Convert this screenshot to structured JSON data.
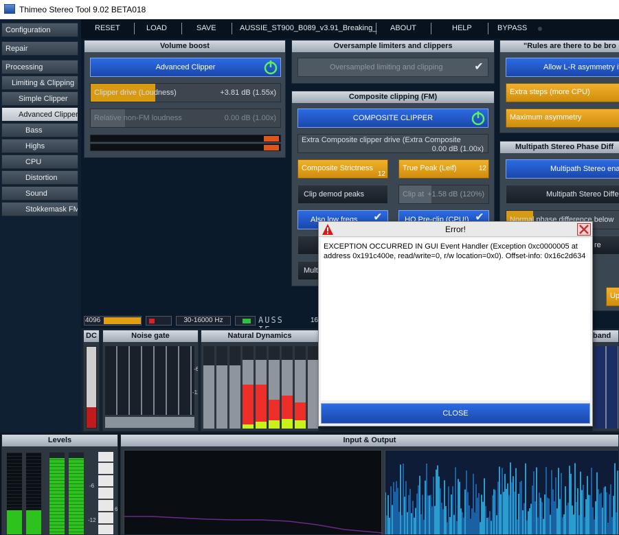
{
  "window": {
    "title": "Thimeo Stereo Tool 9.02 BETA018"
  },
  "nav": {
    "items": [
      {
        "label": "Configuration"
      },
      {
        "label": "Repair"
      },
      {
        "label": "Processing"
      },
      {
        "label": "Limiting & Clipping"
      },
      {
        "label": "Simple Clipper"
      },
      {
        "label": "Advanced Clipper"
      },
      {
        "label": "Bass"
      },
      {
        "label": "Highs"
      },
      {
        "label": "CPU"
      },
      {
        "label": "Distortion"
      },
      {
        "label": "Sound"
      },
      {
        "label": "Stokkemask FM"
      }
    ]
  },
  "menu": {
    "reset": "RESET",
    "load": "LOAD",
    "save": "SAVE",
    "preset": "AUSSIE_ST900_B089_v3.91_Breaking_",
    "about": "ABOUT",
    "help": "HELP",
    "bypass": "BYPASS"
  },
  "volume_boost": {
    "title": "Volume boost",
    "advanced_clipper": "Advanced Clipper",
    "clipper_drive_label": "Clipper drive (Loudness)",
    "clipper_drive_value": "+3.81 dB (1.55x)",
    "clipper_drive_fill": 0.34,
    "relative_label": "Relative non-FM loudness",
    "relative_value": "0.00 dB (1.00x)"
  },
  "oversample": {
    "title": "Oversample limiters and clippers",
    "button": "Oversampled limiting and clipping"
  },
  "composite": {
    "title": "Composite clipping (FM)",
    "button": "COMPOSITE CLIPPER",
    "extra_drive_line1": "Extra Composite clipper drive (Extra Composite",
    "extra_drive_value": "0.00 dB (1.00x)",
    "strictness_label": "Composite Strictness",
    "strictness_value": "12",
    "true_peak_label": "True Peak (Leif)",
    "true_peak_value": "12",
    "clip_demod": "Clip demod peaks",
    "clip_at_label": "Clip at",
    "clip_at_value": "+1.58 dB (120%)",
    "also_low_freqs": "Also low freqs",
    "hq_preclip": "HQ Pre-clip (CPU!)",
    "partial_mult": "Mult"
  },
  "rules": {
    "title": "\"Rules are there to be bro",
    "allow_lr": "Allow L-R asymmetry if",
    "extra_steps": "Extra steps (more CPU)",
    "max_asym": "Maximum asymmetry"
  },
  "multipath": {
    "title": "Multipath Stereo Phase Diff",
    "enable": "Multipath Stereo ena",
    "difference": "Multipath Stereo Differ",
    "normal_phase": "Normal phase difference below",
    "partial_re": "re",
    "partial_up": "Up"
  },
  "status": {
    "samples": "4096",
    "freq": "30-16000 Hz",
    "display": "AUSS IE",
    "num": "16"
  },
  "bottom": {
    "dc": "DC",
    "noise_gate": "Noise gate",
    "natural_dynamics": "Natural Dynamics",
    "partial_band": "band",
    "levels": "Levels",
    "io": "Input & Output",
    "tick_minus6": "-6",
    "tick_minus12": "-12",
    "tick_6": "6"
  },
  "dialog": {
    "title": "Error!",
    "message": "EXCEPTION OCCURRED IN GUI Event Handler (Exception 0xc0000005 at address 0x191c400e, read/write=0, r/w location=0x0). Offset-info: 0x16c2d634",
    "close": "CLOSE"
  }
}
